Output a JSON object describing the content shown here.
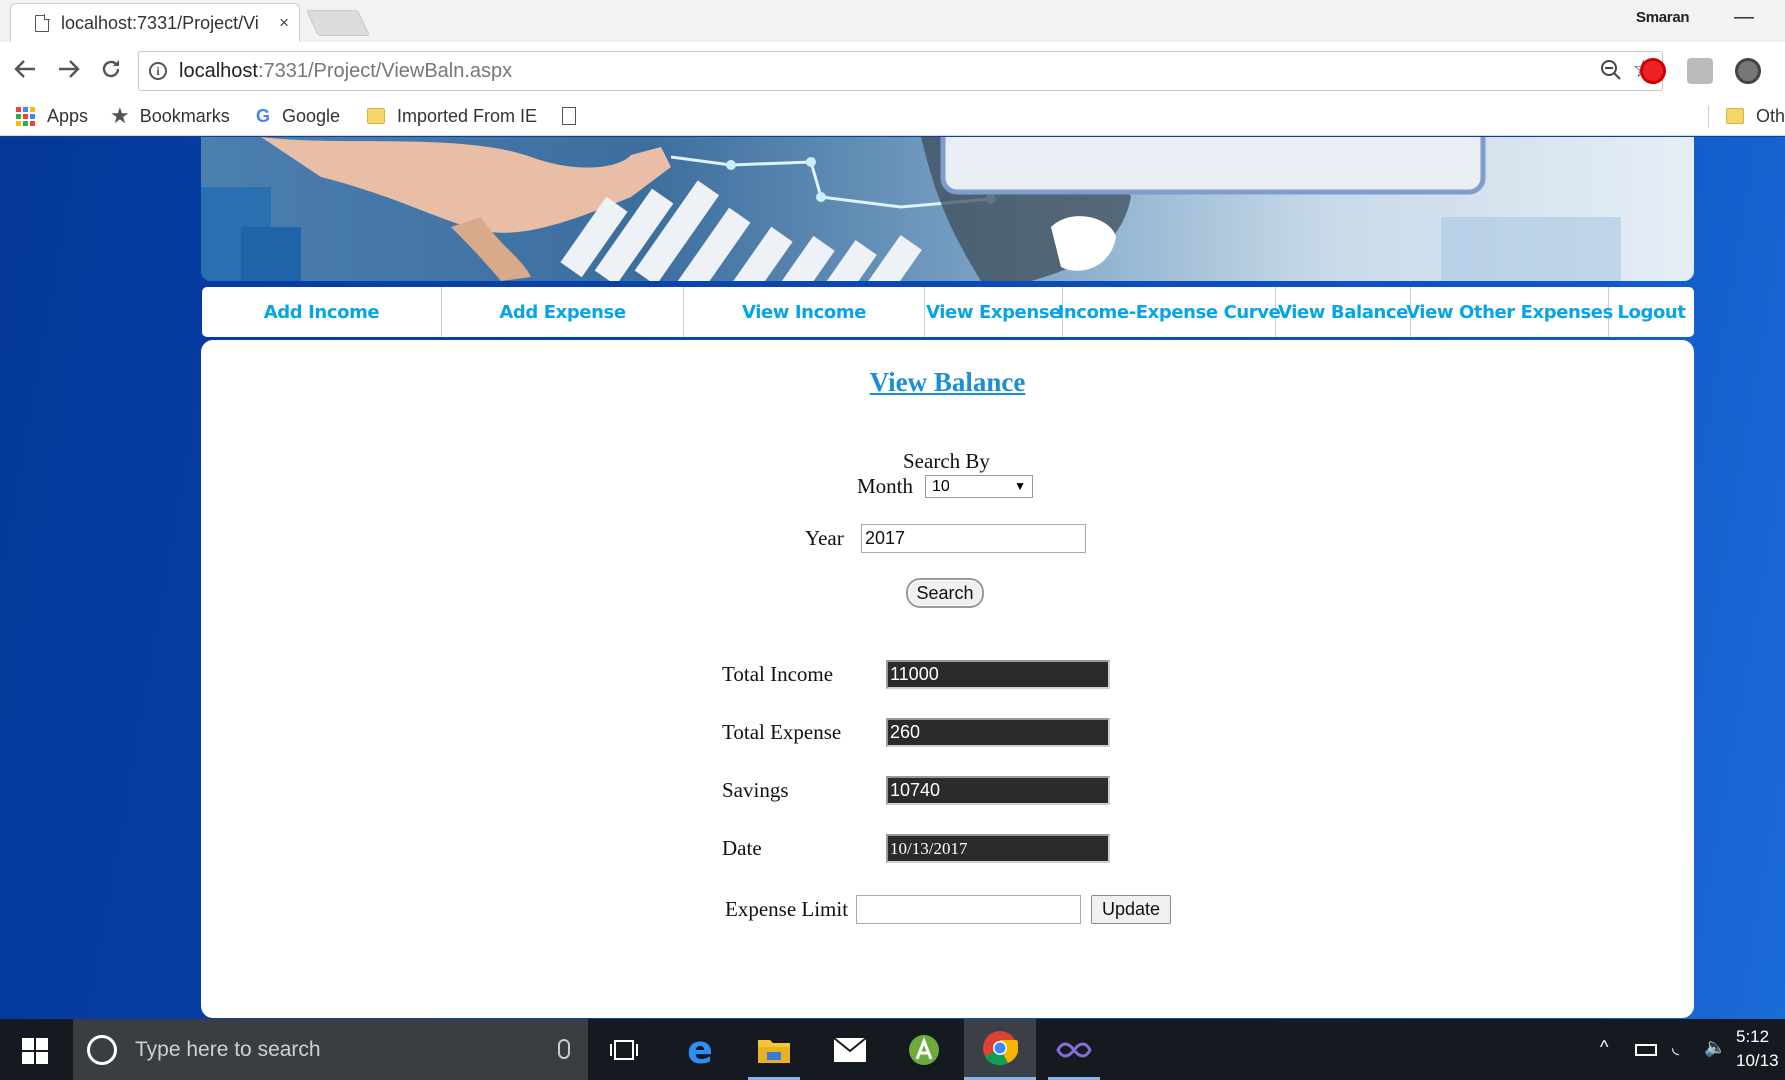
{
  "browser": {
    "tab_title": "localhost:7331/Project/Vi",
    "tab_close": "×",
    "profile_name": "Smaran",
    "minimize": "—",
    "url_host": "localhost",
    "url_rest": ":7331/Project/ViewBaln.aspx",
    "bookmarks": {
      "apps": "Apps",
      "bookmarks": "Bookmarks",
      "google": "Google",
      "imported": "Imported From IE",
      "other": "Oth"
    }
  },
  "nav": [
    {
      "label": "Add Income"
    },
    {
      "label": "Add Expense"
    },
    {
      "label": "View Income"
    },
    {
      "label": "View Expense"
    },
    {
      "label": "Income-Expense Curve"
    },
    {
      "label": "View Balance"
    },
    {
      "label": "View Other Expenses"
    },
    {
      "label": "Logout"
    }
  ],
  "page": {
    "heading": "View Balance",
    "search_by": "Search By",
    "month_label": "Month",
    "month_value": "10",
    "year_label": "Year",
    "year_value": "2017",
    "search_button": "Search",
    "total_income_label": "Total Income",
    "total_income_value": "11000",
    "total_expense_label": "Total Expense",
    "total_expense_value": "260",
    "savings_label": "Savings",
    "savings_value": "10740",
    "date_label": "Date",
    "date_value": "10/13/2017",
    "expense_limit_label": "Expense Limit",
    "expense_limit_value": "",
    "update_button": "Update"
  },
  "taskbar": {
    "search_placeholder": "Type here to search",
    "time": "5:12",
    "date": "10/13"
  },
  "colors": {
    "nav_text": "#08a4e8",
    "heading": "#1a8fd8",
    "page_bg": "#0a48b3"
  }
}
